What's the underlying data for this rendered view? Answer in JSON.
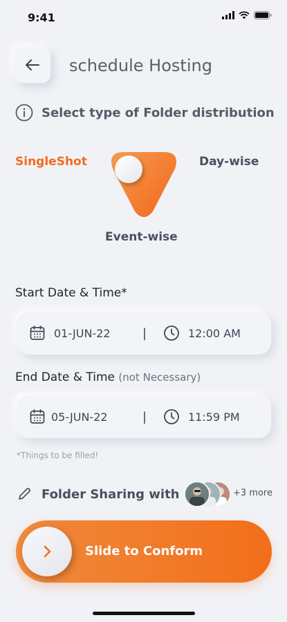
{
  "status_bar": {
    "time": "9:41"
  },
  "header": {
    "title": "schedule Hosting"
  },
  "info": {
    "label": "Select type of Folder distribution"
  },
  "distribution": {
    "options": [
      "SingleShot",
      "Day-wise",
      "Event-wise"
    ],
    "selected": "SingleShot",
    "accent": "#F46A1E"
  },
  "start": {
    "label": "Start Date & Time*",
    "date": "01-JUN-22",
    "time": "12:00 AM"
  },
  "end": {
    "label": "End Date & Time",
    "label_note": "(not Necessary)",
    "date": "05-JUN-22",
    "time": "11:59 PM"
  },
  "separator": "|",
  "hint": "*Things to be filled!",
  "sharing": {
    "label": "Folder Sharing with",
    "more": "+3 more"
  },
  "slider": {
    "label": "Slide to Conform"
  }
}
